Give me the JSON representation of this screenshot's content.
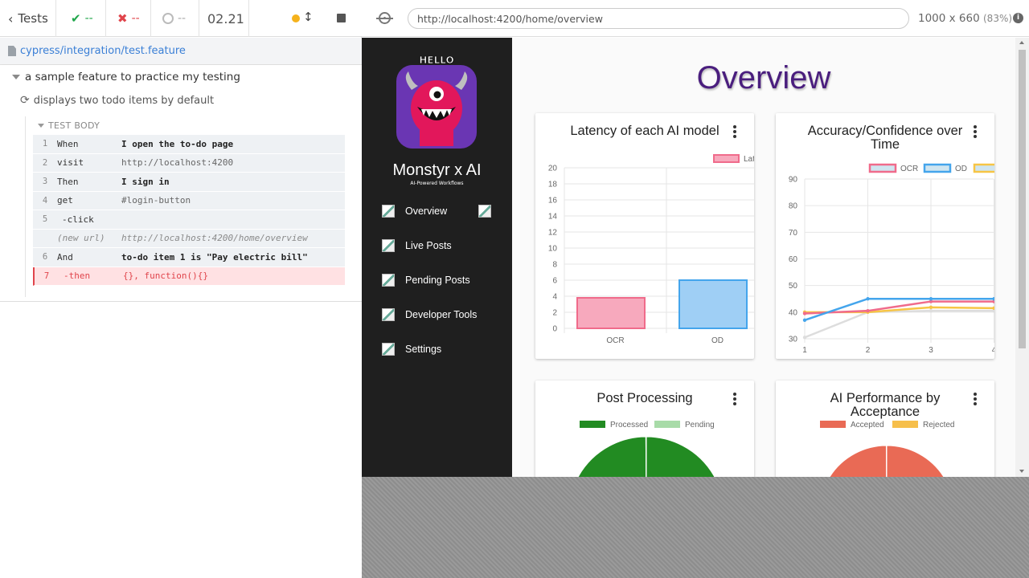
{
  "reporter": {
    "tests_label": "Tests",
    "passed": "--",
    "failed": "--",
    "pending": "--",
    "duration": "02.21",
    "spec_file": "cypress/integration/test.feature",
    "suite_title": "a sample feature to practice my testing",
    "test_title": "displays two todo items by default",
    "test_body_label": "TEST BODY",
    "commands": [
      {
        "num": "1",
        "name": "When",
        "message": "I open the to-do page",
        "bold": true
      },
      {
        "num": "2",
        "name": "visit",
        "message": "http://localhost:4200",
        "bold": false
      },
      {
        "num": "3",
        "name": "Then",
        "message": "I sign in",
        "bold": true
      },
      {
        "num": "4",
        "name": "get",
        "message": "#login-button",
        "bold": false
      },
      {
        "num": "5",
        "name": "-click",
        "message": "",
        "bold": false
      },
      {
        "num": "",
        "name": "(new url)",
        "message": "http://localhost:4200/home/overview",
        "bold": false
      },
      {
        "num": "6",
        "name": "And",
        "message": "to-do item 1 is \"Pay electric bill\"",
        "bold": true
      },
      {
        "num": "7",
        "name": "-then",
        "message": "{}, function(){}",
        "bold": false
      }
    ],
    "colors": {
      "pass": "#1fa64a",
      "fail": "#e0444b",
      "running": "#f5b21c"
    }
  },
  "aut_header": {
    "url": "http://localhost:4200/home/overview",
    "viewport": "1000 x 660",
    "scale": "(83%)"
  },
  "app": {
    "logo_text": "HELLO",
    "brand": "Monstyr x AI",
    "tagline": "AI-Powered Workflows",
    "nav": [
      "Overview",
      "Live Posts",
      "Pending Posts",
      "Developer Tools",
      "Settings"
    ],
    "page_title": "Overview",
    "cards": {
      "latency": {
        "title": "Latency of each AI model"
      },
      "accuracy": {
        "title_line1": "Accuracy/Confidence over",
        "title_line2": "Time"
      },
      "post_processing": {
        "title": "Post Processing"
      },
      "ai_performance": {
        "title_line1": "AI Performance by",
        "title_line2": "Acceptance"
      }
    }
  },
  "chart_data": [
    {
      "type": "bar",
      "title": "Latency of each AI model",
      "categories": [
        "OCR",
        "OD"
      ],
      "series": [
        {
          "name": "Latency",
          "values": [
            3.8,
            6.0
          ],
          "colors": [
            "#f7a9bd",
            "#9fcff5"
          ],
          "borders": [
            "#f06b8b",
            "#44a5ec"
          ]
        }
      ],
      "ylim": [
        0,
        20
      ],
      "yticks": [
        0,
        2,
        4,
        6,
        8,
        10,
        12,
        14,
        16,
        18,
        20
      ],
      "legend": "top-right"
    },
    {
      "type": "line",
      "title": "Accuracy/Confidence over Time",
      "x": [
        1,
        2,
        3,
        4
      ],
      "series": [
        {
          "name": "OCR",
          "values": [
            39.5,
            40.5,
            44,
            44
          ],
          "color": "#f06b8b"
        },
        {
          "name": "OD",
          "values": [
            37,
            45,
            45,
            45
          ],
          "color": "#44a5ec"
        },
        {
          "name": "",
          "values": [
            40,
            40,
            41.8,
            41.5
          ],
          "color": "#f7c545"
        },
        {
          "values": [
            30.5,
            40,
            40.5,
            40.5
          ],
          "color": "#dddddd"
        }
      ],
      "ylim": [
        30,
        90
      ],
      "yticks": [
        30,
        40,
        50,
        60,
        70,
        80,
        90
      ],
      "legend": "top"
    },
    {
      "type": "pie",
      "title": "Post Processing",
      "categories": [
        "Processed",
        "Pending"
      ],
      "colors": [
        "#228b22",
        "#a8dba8"
      ],
      "legend": "top"
    },
    {
      "type": "pie",
      "title": "AI Performance by Acceptance",
      "categories": [
        "Accepted",
        "Rejected"
      ],
      "colors": [
        "#e96a55",
        "#f6bf4b"
      ],
      "legend": "top"
    }
  ]
}
